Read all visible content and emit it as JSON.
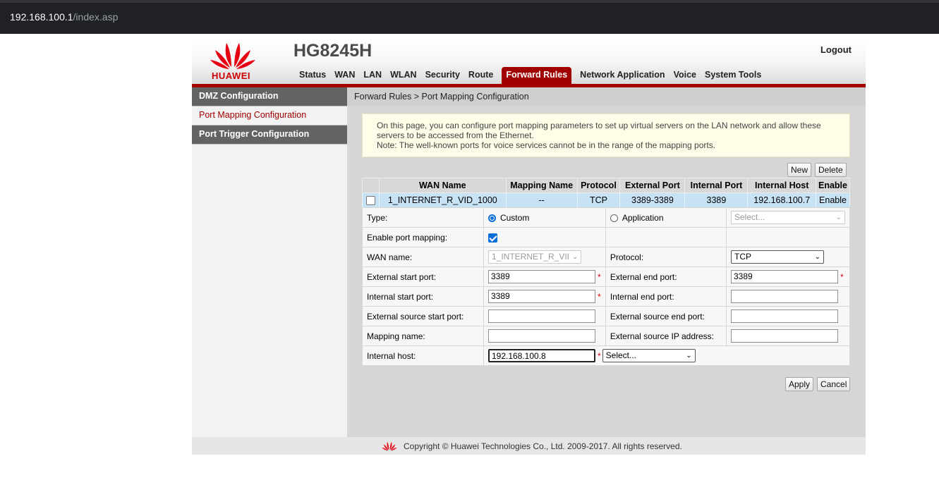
{
  "browser": {
    "url_host": "192.168.100.1",
    "url_path": "/index.asp"
  },
  "header": {
    "brand": "HUAWEI",
    "model": "HG8245H",
    "logout": "Logout",
    "nav": [
      "Status",
      "WAN",
      "LAN",
      "WLAN",
      "Security",
      "Route",
      "Forward Rules",
      "Network Application",
      "Voice",
      "System Tools"
    ],
    "active_nav": "Forward Rules"
  },
  "sidebar": {
    "items": [
      "DMZ Configuration",
      "Port Mapping Configuration",
      "Port Trigger Configuration"
    ],
    "active": "Port Mapping Configuration"
  },
  "breadcrumb": "Forward Rules > Port Mapping Configuration",
  "note": {
    "line1": "On this page, you can configure port mapping parameters to set up virtual servers on the LAN network and allow these",
    "line2": "servers to be accessed from the Ethernet.",
    "line3": "Note: The well-known ports for voice services cannot be in the range of the mapping ports."
  },
  "actions": {
    "new": "New",
    "delete": "Delete",
    "apply": "Apply",
    "cancel": "Cancel"
  },
  "table": {
    "headers": [
      "WAN Name",
      "Mapping Name",
      "Protocol",
      "External Port",
      "Internal Port",
      "Internal Host",
      "Enable"
    ],
    "rows": [
      {
        "wan_name": "1_INTERNET_R_VID_1000",
        "mapping_name": "--",
        "protocol": "TCP",
        "external_port": "3389-3389",
        "internal_port": "3389",
        "internal_host": "192.168.100.7",
        "enable": "Enable"
      }
    ]
  },
  "form": {
    "type_label": "Type:",
    "type_custom": "Custom",
    "type_application": "Application",
    "type_selected": "Custom",
    "app_select_placeholder": "Select...",
    "enable_label": "Enable port mapping:",
    "enable_checked": true,
    "wan_label": "WAN name:",
    "wan_value": "1_INTERNET_R_VII",
    "protocol_label": "Protocol:",
    "protocol_value": "TCP",
    "ext_start_label": "External start port:",
    "ext_start_value": "3389",
    "ext_end_label": "External end port:",
    "ext_end_value": "3389",
    "int_start_label": "Internal start port:",
    "int_start_value": "3389",
    "int_end_label": "Internal end port:",
    "int_end_value": "",
    "src_start_label": "External source start port:",
    "src_start_value": "",
    "src_end_label": "External source end port:",
    "src_end_value": "",
    "mapping_name_label": "Mapping name:",
    "mapping_name_value": "",
    "src_ip_label": "External source IP address:",
    "src_ip_value": "",
    "internal_host_label": "Internal host:",
    "internal_host_value": "192.168.100.8",
    "host_select": "Select...",
    "required_mark": "*"
  },
  "footer": {
    "copyright": "Copyright © Huawei Technologies Co., Ltd. 2009-2017. All rights reserved."
  },
  "colors": {
    "accent": "#a00000",
    "row_highlight": "#c7e2f5",
    "note_bg": "#fdfde8",
    "sidebar_dark": "#636363"
  }
}
